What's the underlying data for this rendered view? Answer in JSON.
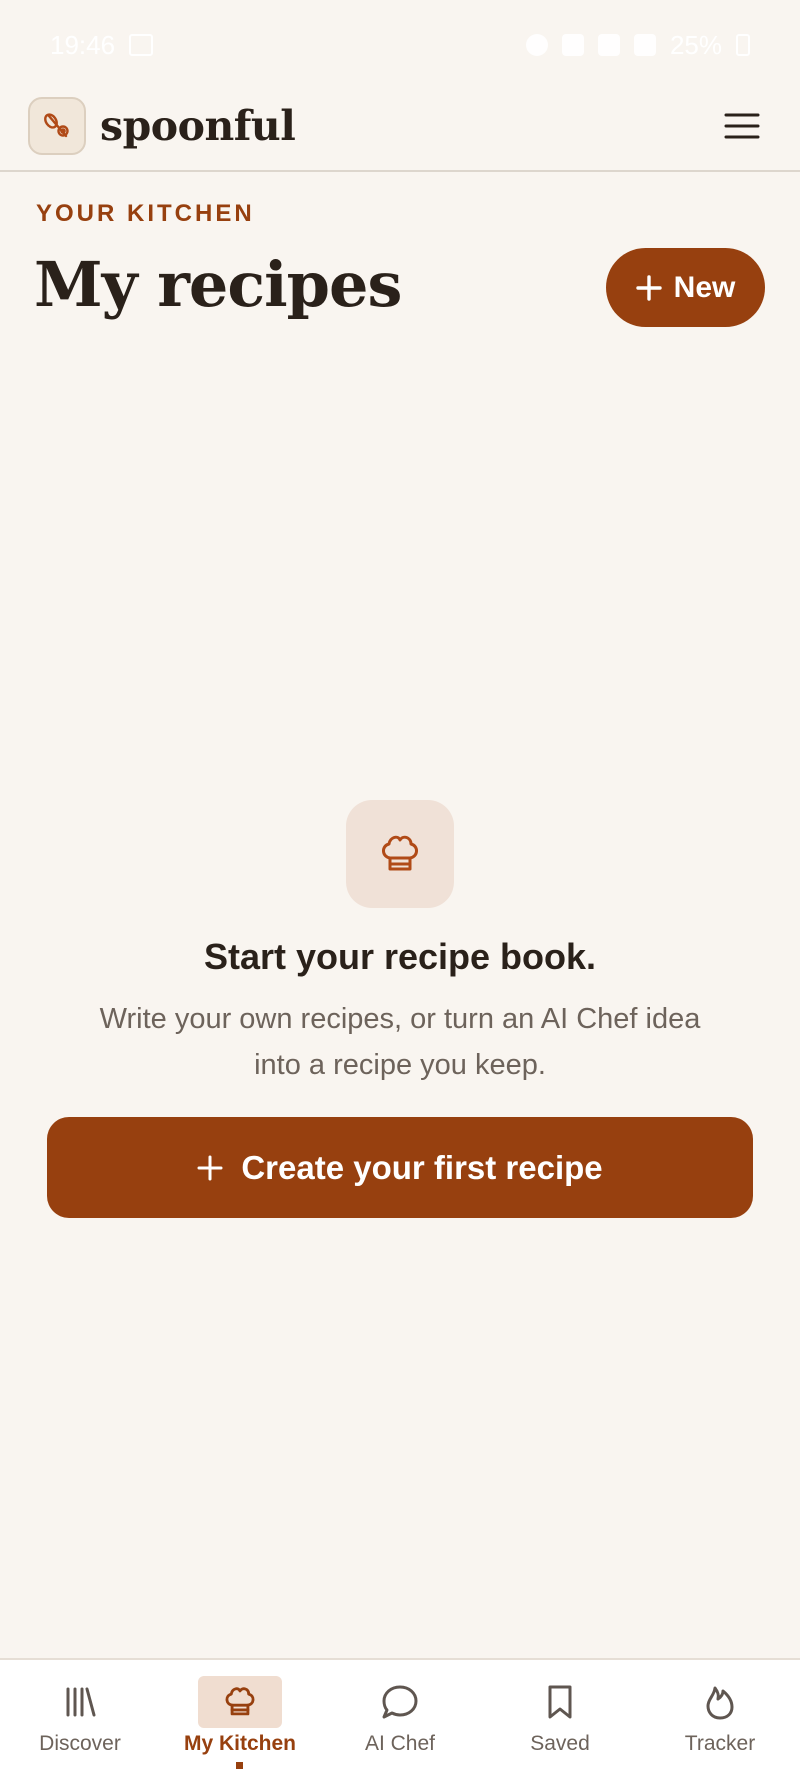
{
  "status_bar": {
    "time": "19:46",
    "battery": "25%"
  },
  "app": {
    "name": "spoonful"
  },
  "header": {
    "eyebrow": "YOUR KITCHEN",
    "title": "My recipes",
    "new_button_label": "New"
  },
  "empty_state": {
    "title": "Start your recipe book.",
    "description": "Write your own recipes, or turn an AI Chef idea into a recipe you keep.",
    "cta_label": "Create your first recipe"
  },
  "nav": {
    "items": [
      {
        "label": "Discover",
        "icon": "library-icon"
      },
      {
        "label": "My Kitchen",
        "icon": "chef-hat-icon",
        "active": true
      },
      {
        "label": "AI Chef",
        "icon": "chat-bubble-icon"
      },
      {
        "label": "Saved",
        "icon": "bookmark-icon"
      },
      {
        "label": "Tracker",
        "icon": "flame-icon"
      }
    ]
  },
  "colors": {
    "accent": "#97400f",
    "background": "#f9f5f0",
    "text": "#2a211a",
    "muted": "#6d635b"
  }
}
